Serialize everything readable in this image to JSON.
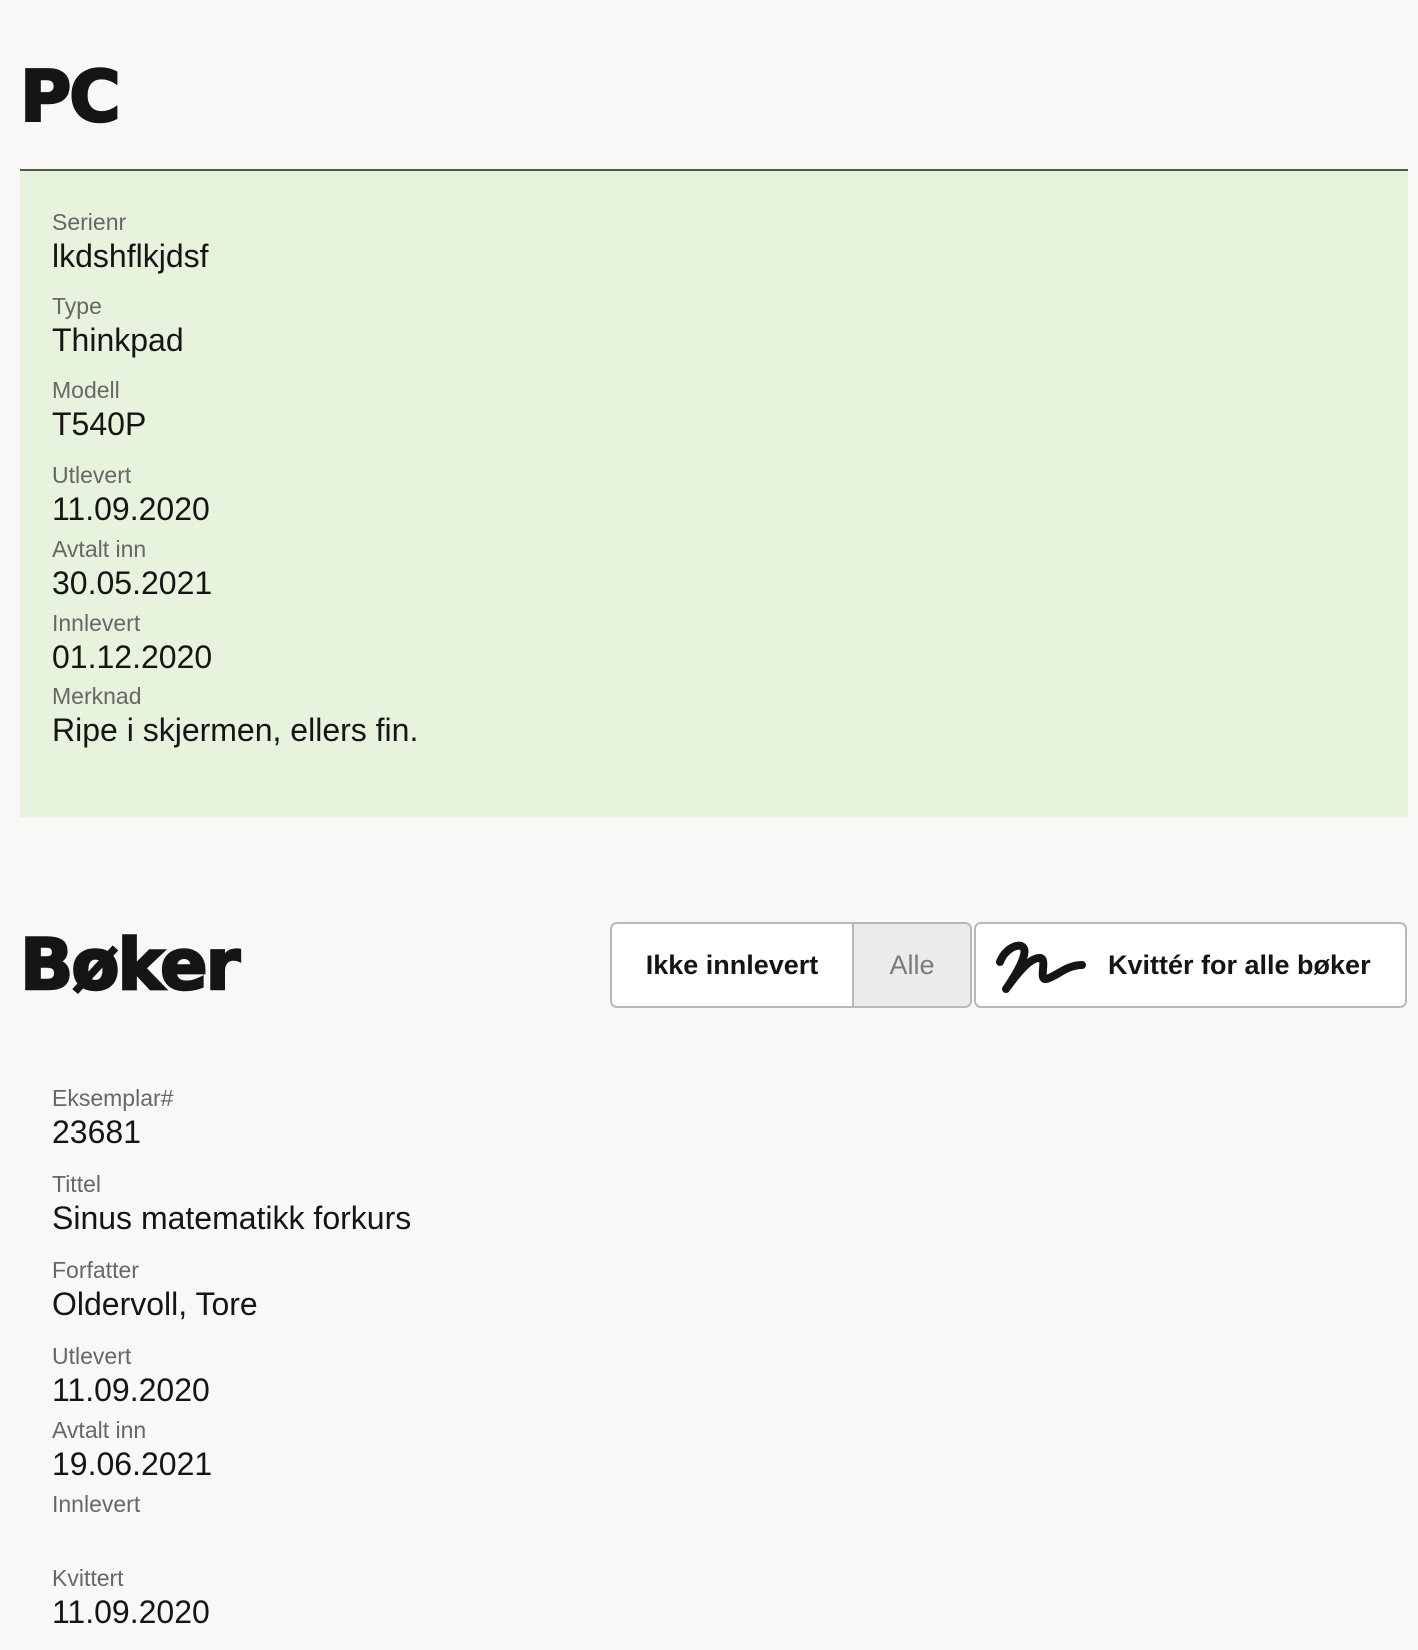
{
  "pc": {
    "title": "PC",
    "fields": [
      {
        "label": "Serienr",
        "value": "lkdshflkjdsf"
      },
      {
        "label": "Type",
        "value": "Thinkpad"
      },
      {
        "label": "Modell",
        "value": "T540P"
      },
      {
        "label": "Utlevert",
        "value": "11.09.2020"
      },
      {
        "label": "Avtalt inn",
        "value": "30.05.2021"
      },
      {
        "label": "Innlevert",
        "value": "01.12.2020"
      },
      {
        "label": "Merknad",
        "value": "Ripe i skjermen, ellers fin."
      }
    ]
  },
  "books": {
    "title": "Bøker",
    "filter": {
      "not_returned_label": "Ikke innlevert",
      "all_label": "Alle",
      "selected": "Alle"
    },
    "sign_all": {
      "label": "Kvittér for alle bøker",
      "icon": "signature-icon"
    },
    "item": {
      "fields": [
        {
          "label": "Eksemplar#",
          "value": "23681"
        },
        {
          "label": "Tittel",
          "value": "Sinus matematikk forkurs"
        },
        {
          "label": "Forfatter",
          "value": "Oldervoll, Tore"
        },
        {
          "label": "Utlevert",
          "value": "11.09.2020"
        },
        {
          "label": "Avtalt inn",
          "value": "19.06.2021"
        },
        {
          "label": "Innlevert",
          "value": ""
        },
        {
          "label": "Kvittert",
          "value": "11.09.2020"
        }
      ]
    }
  },
  "colors": {
    "background": "#f9f8f6",
    "pc_panel": "#e7f3dd",
    "panel_border": "#4d5a46",
    "label_text": "#676767",
    "value_text": "#151515",
    "selected_filter_bg": "#ebebe9"
  }
}
